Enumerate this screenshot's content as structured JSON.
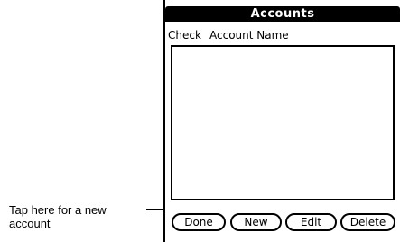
{
  "window": {
    "title": "Accounts"
  },
  "columns": {
    "check": "Check",
    "account_name": "Account Name"
  },
  "account_list": [],
  "buttons": {
    "done": "Done",
    "new": "New",
    "edit": "Edit",
    "delete": "Delete"
  },
  "callout": {
    "line1": "Tap here for a new",
    "line2": "account"
  }
}
